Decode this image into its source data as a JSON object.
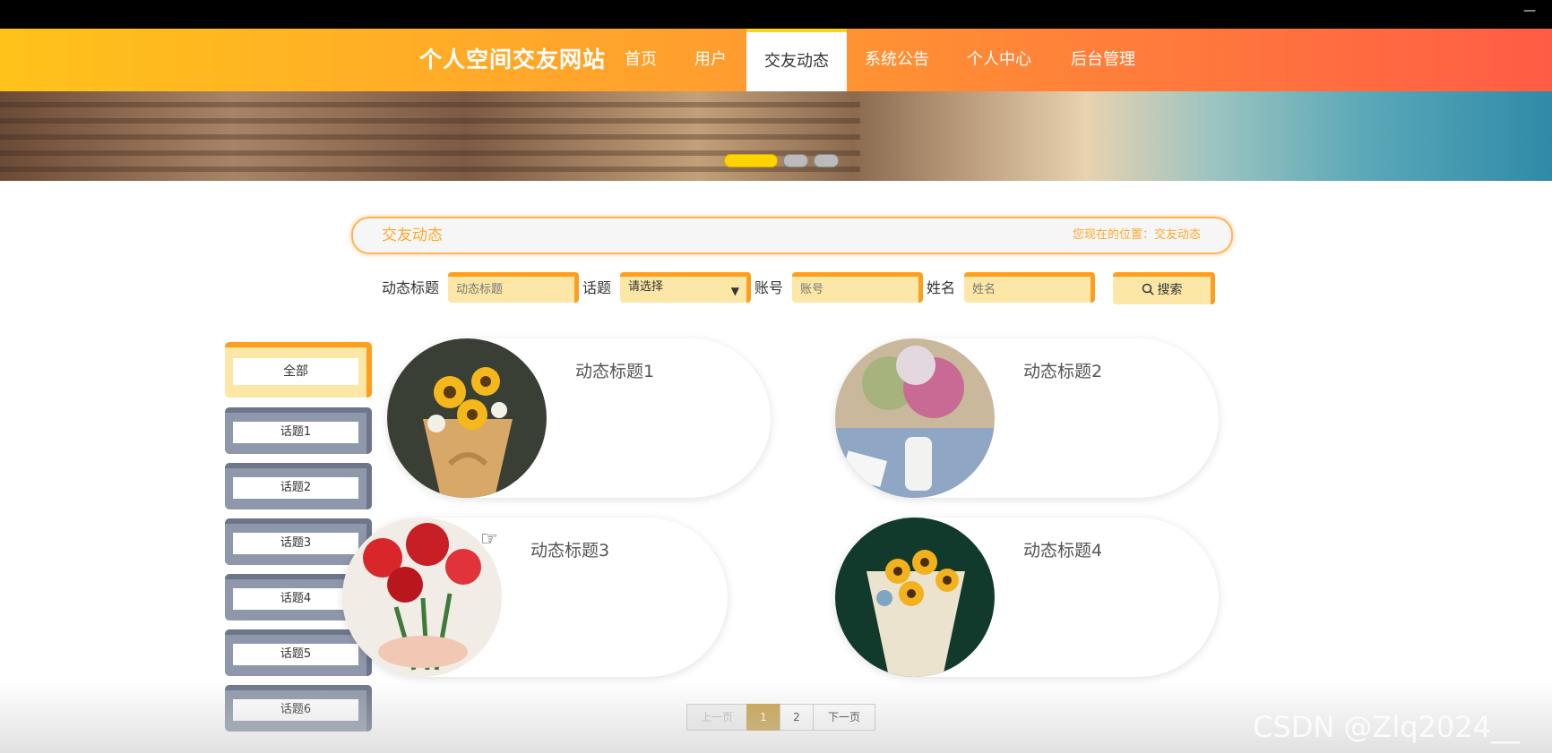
{
  "window": {
    "minimize_glyph": "—"
  },
  "nav": {
    "site_title": "个人空间交友网站",
    "items": [
      {
        "label": "首页",
        "active": false
      },
      {
        "label": "用户",
        "active": false
      },
      {
        "label": "交友动态",
        "active": true
      },
      {
        "label": "系统公告",
        "active": false
      },
      {
        "label": "个人中心",
        "active": false
      },
      {
        "label": "后台管理",
        "active": false
      }
    ]
  },
  "banner": {
    "carousel_count": 3,
    "active_index": 0
  },
  "breadcrumb": {
    "title": "交友动态",
    "location": "您现在的位置：交友动态"
  },
  "search": {
    "title_label": "动态标题",
    "title_placeholder": "动态标题",
    "topic_label": "话题",
    "topic_selected": "请选择",
    "account_label": "账号",
    "account_placeholder": "账号",
    "name_label": "姓名",
    "name_placeholder": "姓名",
    "button_label": "搜索",
    "button_icon": "search-icon"
  },
  "sidebar": {
    "items": [
      {
        "label": "全部",
        "active": true
      },
      {
        "label": "话题1",
        "active": false
      },
      {
        "label": "话题2",
        "active": false
      },
      {
        "label": "话题3",
        "active": false
      },
      {
        "label": "话题4",
        "active": false
      },
      {
        "label": "话题5",
        "active": false
      },
      {
        "label": "话题6",
        "active": false
      }
    ]
  },
  "posts": [
    {
      "title": "动态标题1",
      "image": "sunflower-bouquet"
    },
    {
      "title": "动态标题2",
      "image": "pink-flowers-vase"
    },
    {
      "title": "动态标题3",
      "image": "red-roses"
    },
    {
      "title": "动态标题4",
      "image": "sunflower-bouquet-dark"
    }
  ],
  "pagination": {
    "prev_label": "上一页",
    "pages": [
      "1",
      "2"
    ],
    "current_page": "1",
    "next_label": "下一页"
  },
  "watermark": "CSDN @Zlq2024__"
}
